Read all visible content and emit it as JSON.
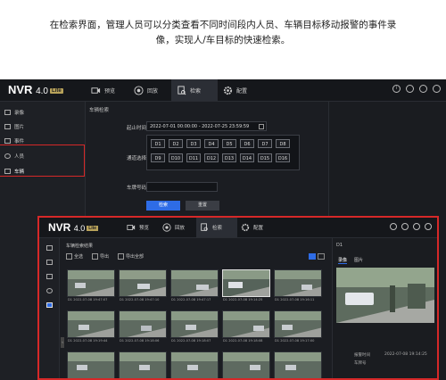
{
  "caption": {
    "line1": "在检索界面，管理人员可以分类查看不同时间段内人员、车辆目标移动报警的事件录",
    "line2": "像，实现人/车目标的快速检索。"
  },
  "app": {
    "logo": "NVR",
    "version": "4.0",
    "edition": "Lite"
  },
  "nav": {
    "tabs": [
      {
        "label": "预览"
      },
      {
        "label": "回放"
      },
      {
        "label": "检索"
      },
      {
        "label": "配置"
      }
    ]
  },
  "sidebar": {
    "items": [
      {
        "label": "录像"
      },
      {
        "label": "图片"
      },
      {
        "label": "事件"
      },
      {
        "label": "人员"
      },
      {
        "label": "车辆"
      }
    ]
  },
  "search": {
    "panel_title": "车辆检索",
    "time_label": "起止时间",
    "time_value": "2022-07-01 00:00:00 - 2022-07-25 23:59:59",
    "channel_label": "通道选择",
    "channels": [
      "D1",
      "D2",
      "D3",
      "D4",
      "D5",
      "D6",
      "D7",
      "D8",
      "D9",
      "D10",
      "D11",
      "D12",
      "D13",
      "D14",
      "D15",
      "D16"
    ],
    "plate_label": "车牌号码",
    "plate_value": "",
    "search_button": "检索",
    "reset_button": "重置"
  },
  "results": {
    "title": "车辆检索结果",
    "toolbar": [
      "全选",
      "导出",
      "导出全部"
    ],
    "captions": [
      {
        "channel": "D1",
        "time": "2022-07-08 19:47:07"
      },
      {
        "channel": "D1",
        "time": "2022-07-08 19:47:10"
      },
      {
        "channel": "D1",
        "time": "2022-07-08 19:47:17"
      },
      {
        "channel": "D1",
        "time": "2022-07-08 19:14:25"
      },
      {
        "channel": "D1",
        "time": "2022-07-08 19:16:11"
      },
      {
        "channel": "D1",
        "time": "2022-07-08 19:19:44"
      },
      {
        "channel": "D1",
        "time": "2022-07-08 19:18:06"
      },
      {
        "channel": "D1",
        "time": "2022-07-08 19:18:07"
      },
      {
        "channel": "D1",
        "time": "2022-07-08 19:18:08"
      },
      {
        "channel": "D1",
        "time": "2022-07-08 19:17:00"
      }
    ],
    "detail": {
      "channel": "D1",
      "tabs": [
        "录像",
        "图片"
      ],
      "alarm_time_label": "报警时间",
      "alarm_time": "2022-07-08 19:14:25",
      "plate_label": "车牌号"
    }
  }
}
